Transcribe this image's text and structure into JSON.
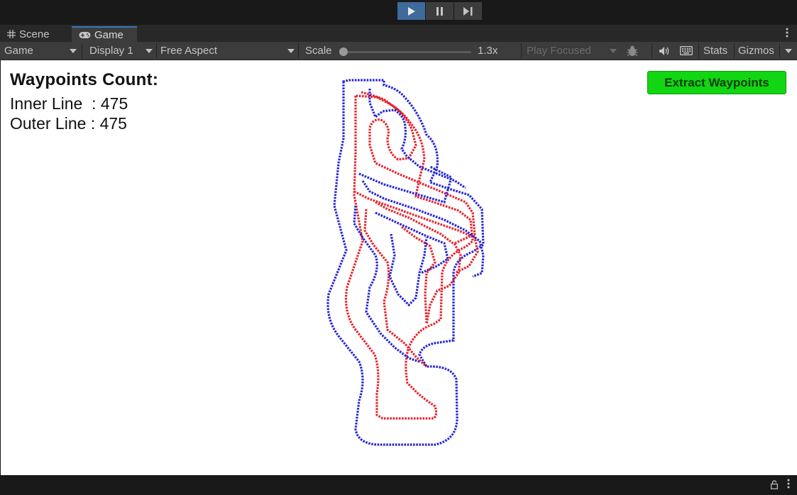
{
  "toolbar": {
    "play_label": "Play",
    "pause_label": "Pause",
    "step_label": "Step"
  },
  "tabs": [
    {
      "label": "Scene",
      "icon": "grid-icon"
    },
    {
      "label": "Game",
      "icon": "gamepad-icon",
      "active": true
    }
  ],
  "game_toolbar": {
    "mode": "Game",
    "display": "Display 1",
    "aspect": "Free Aspect",
    "scale_label": "Scale",
    "scale_value": "1.3x",
    "scale_fraction": 0.0,
    "play_mode": "Play Focused",
    "stats_label": "Stats",
    "gizmos_label": "Gizmos"
  },
  "overlay": {
    "title": "Waypoints Count:",
    "inner_line": "Inner Line  : 475",
    "outer_line": "Outer Line : 475",
    "extract_button": "Extract Waypoints"
  },
  "colors": {
    "inner_waypoints": "#e8222a",
    "outer_waypoints": "#2626d6",
    "extract_button_bg": "#11d611",
    "active_tab_accent": "#3a79bb",
    "play_active": "#3e6a9c"
  }
}
